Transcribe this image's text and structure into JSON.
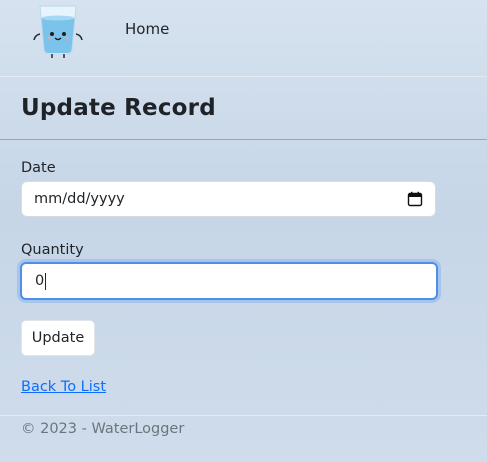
{
  "navbar": {
    "logo_icon": "water-glass-mascot-icon",
    "home_label": "Home"
  },
  "page": {
    "title": "Update Record"
  },
  "form": {
    "date": {
      "label": "Date",
      "value": "mm/dd/yyyy",
      "icon": "calendar-icon"
    },
    "quantity": {
      "label": "Quantity",
      "value": "0"
    },
    "submit_label": "Update"
  },
  "back_link": "Back To List",
  "footer": {
    "text": "© 2023 - WaterLogger"
  },
  "colors": {
    "accent": "#0d6efd",
    "focus_border": "#4f8fe8",
    "footer_text": "#6c757d"
  }
}
